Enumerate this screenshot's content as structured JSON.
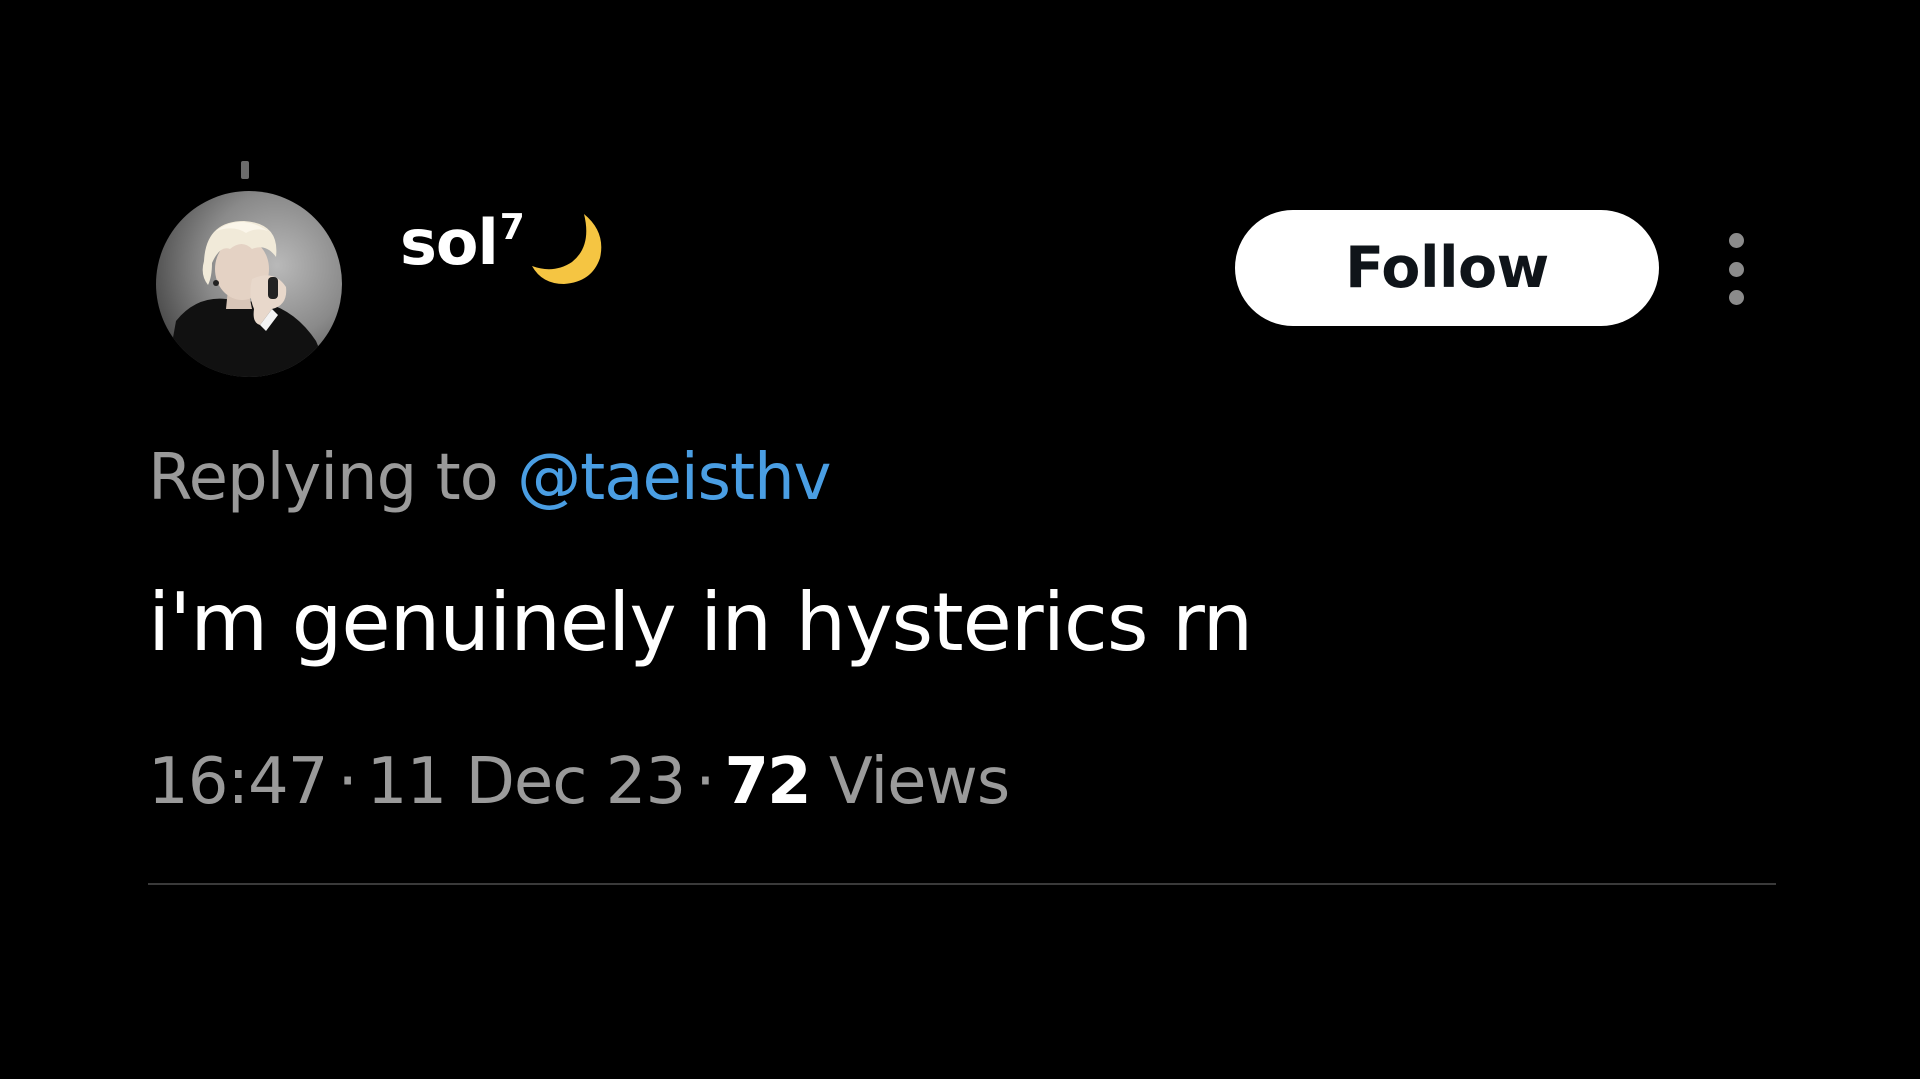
{
  "author": {
    "display_name": "sol",
    "name_superscript": "7",
    "name_emoji": "crescent-moon-icon"
  },
  "reply": {
    "prefix": "Replying to",
    "handle": "@taeisthv"
  },
  "tweet": {
    "text": "i'm genuinely in hysterics rn"
  },
  "meta": {
    "time": "16:47",
    "separator": "·",
    "date": "11 Dec 23",
    "views_count": "72",
    "views_label": "Views"
  },
  "actions": {
    "follow_label": "Follow",
    "more_icon": "more-vertical-icon"
  },
  "colors": {
    "background": "#000000",
    "primary_text": "#ffffff",
    "secondary_text": "#9a9a9a",
    "link": "#4a9ee3",
    "follow_bg": "#ffffff",
    "follow_text": "#0f1419",
    "moon": "#f5c542"
  }
}
